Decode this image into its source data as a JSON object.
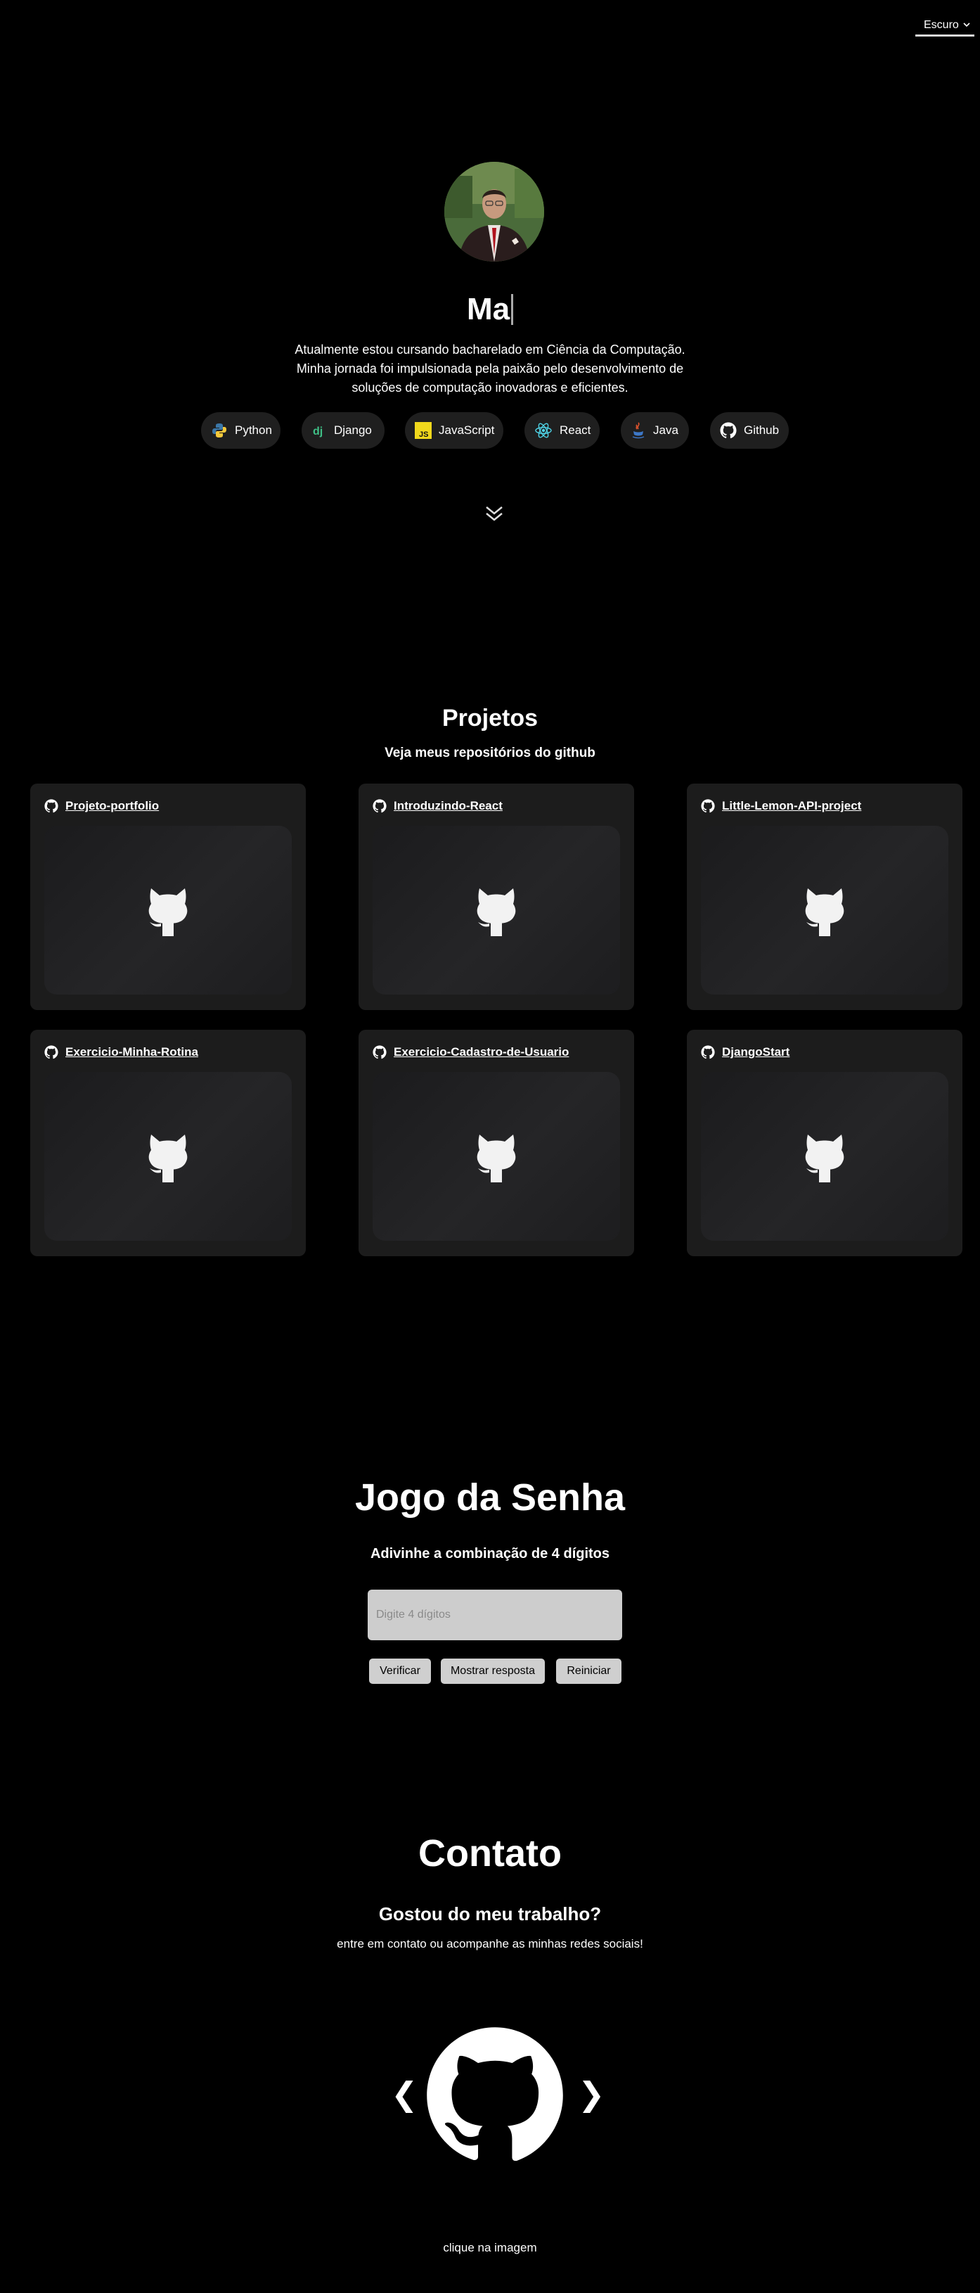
{
  "theme_select": {
    "selected": "Escuro"
  },
  "hero": {
    "title_typed": "Ma",
    "description": "Atualmente estou cursando bacharelado em Ciência da Computação. Minha jornada foi impulsionada pela paixão pelo desenvolvimento de soluções de computação inovadoras e eficientes.",
    "skills": [
      {
        "label": "Python",
        "icon": "python-icon"
      },
      {
        "label": "Django",
        "icon": "django-icon"
      },
      {
        "label": "JavaScript",
        "icon": "javascript-icon"
      },
      {
        "label": "React",
        "icon": "react-icon"
      },
      {
        "label": "Java",
        "icon": "java-icon"
      },
      {
        "label": "Github",
        "icon": "github-icon"
      }
    ]
  },
  "projects": {
    "title": "Projetos",
    "subtitle": "Veja meus repositórios do github",
    "items": [
      {
        "name": "Projeto-portfolio"
      },
      {
        "name": "Introduzindo-React"
      },
      {
        "name": "Little-Lemon-API-project"
      },
      {
        "name": "Exercicio-Minha-Rotina"
      },
      {
        "name": "Exercicio-Cadastro-de-Usuario"
      },
      {
        "name": "DjangoStart"
      }
    ]
  },
  "game": {
    "title": "Jogo da Senha",
    "subtitle": "Adivinhe a combinação de 4 dígitos",
    "input_placeholder": "Digite 4 dígitos",
    "input_value": "",
    "buttons": {
      "verify": "Verificar",
      "show": "Mostrar resposta",
      "reset": "Reiniciar"
    }
  },
  "contact": {
    "title": "Contato",
    "subtitle": "Gostou do meu trabalho?",
    "text": "entre em contato ou acompanhe as minhas redes sociais!",
    "prev": "❮",
    "next": "❯",
    "hint": "clique na imagem"
  },
  "colors": {
    "background": "#000000",
    "card": "#1c1c1c",
    "pill": "#1f1f1f",
    "button": "#cfcfcf"
  }
}
